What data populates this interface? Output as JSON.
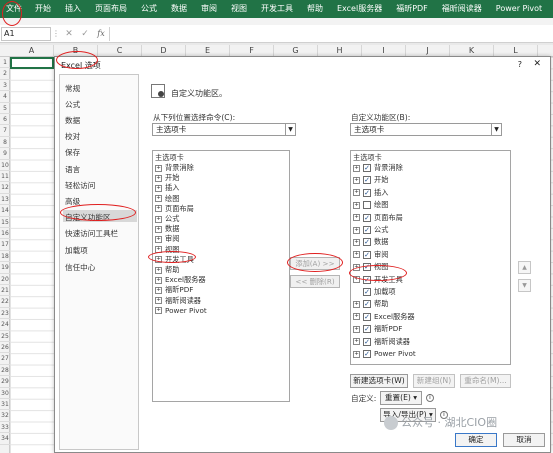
{
  "ribbon": {
    "tabs": [
      "文件",
      "开始",
      "插入",
      "页面布局",
      "公式",
      "数据",
      "审阅",
      "视图",
      "开发工具",
      "帮助",
      "Excel服务器",
      "福昕PDF",
      "福昕阅读器",
      "Power Pivot"
    ],
    "color": "#217346"
  },
  "formula_bar": {
    "name_box": "A1",
    "fx": "fx",
    "cancel": "✕",
    "enter": "✓"
  },
  "grid": {
    "columns": [
      "A",
      "B",
      "C",
      "D",
      "E",
      "F",
      "G",
      "H",
      "I",
      "J",
      "K",
      "L"
    ],
    "rows": [
      "1",
      "2",
      "3",
      "4",
      "5",
      "6",
      "7",
      "8",
      "9",
      "10",
      "11",
      "12",
      "13",
      "14",
      "15",
      "16",
      "17",
      "18",
      "19",
      "20",
      "21",
      "22",
      "23",
      "24",
      "25",
      "26",
      "27",
      "28",
      "29",
      "30",
      "31",
      "32",
      "33",
      "34"
    ]
  },
  "dialog": {
    "title": "Excel 选项",
    "help": "?",
    "close": "✕",
    "nav": [
      "常规",
      "公式",
      "数据",
      "校对",
      "保存",
      "语言",
      "轻松访问",
      "高级",
      "自定义功能区",
      "快速访问工具栏",
      "加载项",
      "信任中心"
    ],
    "nav_selected": "自定义功能区",
    "heading": "自定义功能区。",
    "left_label": "从下列位置选择命令(C):",
    "left_combo": "主选项卡",
    "right_label": "自定义功能区(B):",
    "right_combo": "主选项卡",
    "left_list": {
      "header": "主选项卡",
      "items": [
        "背景消除",
        "开始",
        "插入",
        "绘图",
        "页面布局",
        "公式",
        "数据",
        "审阅",
        "视图",
        "开发工具",
        "帮助",
        "Excel服务器",
        "福昕PDF",
        "福昕阅读器",
        "Power Pivot"
      ]
    },
    "right_list": {
      "header": "主选项卡",
      "items": [
        {
          "label": "背景消除",
          "checked": true,
          "indent": false
        },
        {
          "label": "开始",
          "checked": true,
          "indent": false
        },
        {
          "label": "插入",
          "checked": true,
          "indent": false
        },
        {
          "label": "绘图",
          "checked": false,
          "indent": false
        },
        {
          "label": "页面布局",
          "checked": true,
          "indent": false
        },
        {
          "label": "公式",
          "checked": true,
          "indent": false
        },
        {
          "label": "数据",
          "checked": true,
          "indent": false
        },
        {
          "label": "审阅",
          "checked": true,
          "indent": false
        },
        {
          "label": "视图",
          "checked": true,
          "indent": false
        },
        {
          "label": "开发工具",
          "checked": true,
          "indent": false
        },
        {
          "label": "加载项",
          "checked": true,
          "indent": true
        },
        {
          "label": "帮助",
          "checked": true,
          "indent": false
        },
        {
          "label": "Excel服务器",
          "checked": true,
          "indent": false
        },
        {
          "label": "福昕PDF",
          "checked": true,
          "indent": false
        },
        {
          "label": "福昕阅读器",
          "checked": true,
          "indent": false
        },
        {
          "label": "Power Pivot",
          "checked": true,
          "indent": false
        }
      ]
    },
    "add_button": "添加(A) >>",
    "remove_button": "<< 删除(R)",
    "up": "▲",
    "down": "▼",
    "new_tab": "新建选项卡(W)",
    "new_group": "新建组(N)",
    "rename": "重命名(M)...",
    "customize_label": "自定义:",
    "reset": "重置(E) ▾",
    "import_export": "导入/导出(P) ▾",
    "info": "i",
    "ok": "确定",
    "cancel": "取消"
  },
  "watermark": "公众号 · 湖北CIO圈",
  "colors": {
    "annotation": "#e02020",
    "accent": "#217346"
  }
}
